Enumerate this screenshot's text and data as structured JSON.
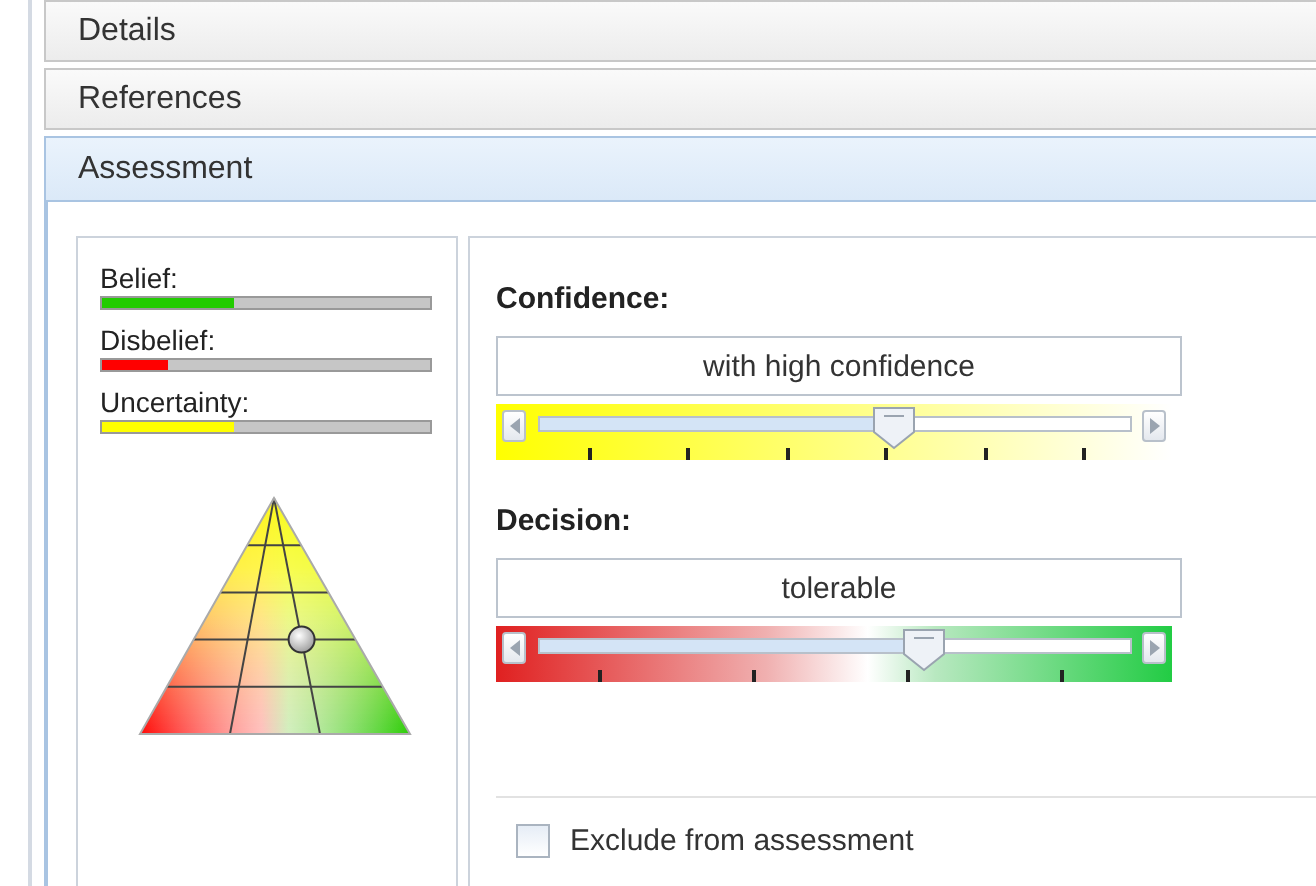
{
  "sections": [
    {
      "title": "Details",
      "expanded": false
    },
    {
      "title": "References",
      "expanded": false
    },
    {
      "title": "Assessment",
      "expanded": true
    }
  ],
  "opinion": [
    {
      "kind": "belief",
      "label": "Belief:",
      "level": 0.4,
      "color": "#22cc00"
    },
    {
      "kind": "disbelief",
      "label": "Disbelief:",
      "level": 0.2,
      "color": "#ff0000"
    },
    {
      "kind": "uncertainty",
      "label": "Uncertainty:",
      "level": 0.4,
      "color": "#ffff00"
    }
  ],
  "sliders": [
    {
      "kind": "confidence",
      "label": "Confidence:",
      "value": "with high confidence",
      "level": 0.6
    },
    {
      "kind": "decision",
      "label": "Decision:",
      "value": "tolerable",
      "level": 0.65
    }
  ],
  "exclude": {
    "label": "Exclude from assessment",
    "checked": false
  }
}
